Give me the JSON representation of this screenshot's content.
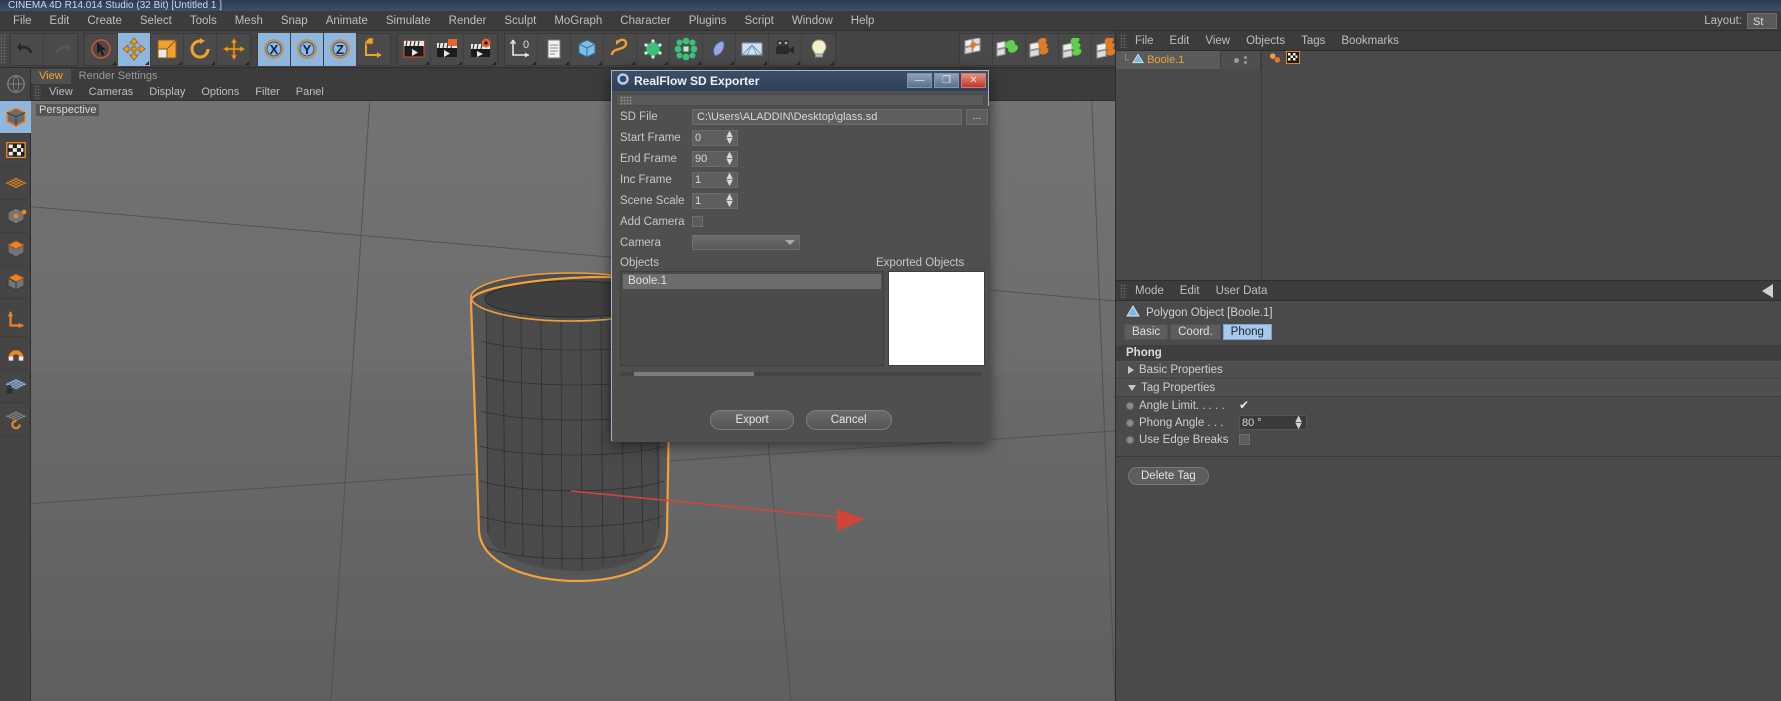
{
  "window": {
    "title": "CINEMA 4D R14.014 Studio (32 Bit)  [Untitled 1 ]"
  },
  "menubar": {
    "items": [
      "File",
      "Edit",
      "Create",
      "Select",
      "Tools",
      "Mesh",
      "Snap",
      "Animate",
      "Simulate",
      "Render",
      "Sculpt",
      "MoGraph",
      "Character",
      "Plugins",
      "Script",
      "Window",
      "Help"
    ],
    "layout_label": "Layout:",
    "layout_value": "St"
  },
  "toolbar": {
    "groups": [
      {
        "name": "history",
        "buttons": [
          {
            "icon": "undo-icon",
            "label": "Undo",
            "active": false,
            "corner": false
          },
          {
            "icon": "redo-icon",
            "label": "Redo",
            "active": false,
            "corner": false
          }
        ]
      },
      {
        "name": "transform",
        "buttons": [
          {
            "icon": "select-cursor-icon",
            "label": "Live Selection",
            "active": false,
            "corner": true
          },
          {
            "icon": "move-icon",
            "label": "Move",
            "active": true,
            "corner": true
          },
          {
            "icon": "scale-icon",
            "label": "Scale",
            "active": false,
            "corner": true
          },
          {
            "icon": "rotate-icon",
            "label": "Rotate",
            "active": false,
            "corner": true
          },
          {
            "icon": "plus-axis-icon",
            "label": "Modelling Axis",
            "active": false,
            "corner": true
          }
        ]
      },
      {
        "name": "axis-lock",
        "buttons": [
          {
            "icon": "x-axis-icon",
            "label": "Lock X Axis",
            "active": true,
            "corner": false
          },
          {
            "icon": "y-axis-icon",
            "label": "Lock Y Axis",
            "active": true,
            "corner": false
          },
          {
            "icon": "z-axis-icon",
            "label": "Lock Z Axis",
            "active": true,
            "corner": false
          },
          {
            "icon": "world-object-axis-icon",
            "label": "World / Object Coordinate System",
            "active": false,
            "corner": false
          }
        ]
      },
      {
        "name": "render",
        "buttons": [
          {
            "icon": "render-view-icon",
            "label": "Render View",
            "active": false,
            "corner": true
          },
          {
            "icon": "render-picture-viewer-icon",
            "label": "Render to Picture Viewer",
            "active": false,
            "corner": true
          },
          {
            "icon": "render-settings-icon",
            "label": "Edit Render Settings",
            "active": false,
            "corner": true
          }
        ]
      },
      {
        "name": "create",
        "buttons": [
          {
            "icon": "null-object-icon",
            "label": "Add Null Object",
            "active": false,
            "corner": true
          },
          {
            "icon": "floor-icon",
            "label": "Add Floor / Scene Object",
            "active": false,
            "corner": true
          },
          {
            "icon": "cube-primitive-icon",
            "label": "Add Cube Primitive",
            "active": false,
            "corner": true
          },
          {
            "icon": "spline-icon",
            "label": "Add Spline",
            "active": false,
            "corner": true
          },
          {
            "icon": "nurbs-icon",
            "label": "Add Generator NURBS",
            "active": false,
            "corner": true
          },
          {
            "icon": "array-icon",
            "label": "Add Modelling Object",
            "active": false,
            "corner": true
          },
          {
            "icon": "deformer-icon",
            "label": "Add Deformer",
            "active": false,
            "corner": true
          },
          {
            "icon": "environment-icon",
            "label": "Add Scene Environment",
            "active": false,
            "corner": true
          },
          {
            "icon": "camera-icon",
            "label": "Add Camera",
            "active": false,
            "corner": true
          },
          {
            "icon": "light-icon",
            "label": "Add Light",
            "active": false,
            "corner": true
          }
        ]
      },
      {
        "name": "snap",
        "buttons": [
          {
            "icon": "snap-quantize-icon",
            "label": "Enable Snapping",
            "active": false,
            "corner": false
          },
          {
            "icon": "snap-vertex-icon",
            "label": "Vertex Snap",
            "active": false,
            "corner": false
          },
          {
            "icon": "snap-edge-icon",
            "label": "Edge Snap",
            "active": false,
            "corner": false
          },
          {
            "icon": "snap-poly-icon",
            "label": "Polygon Snap",
            "active": false,
            "corner": false
          },
          {
            "icon": "snap-workplane-icon",
            "label": "Workplane Snap",
            "active": false,
            "corner": false
          }
        ]
      }
    ]
  },
  "left_toolbar": {
    "buttons": [
      {
        "icon": "make-editable-icon",
        "label": "Make Editable",
        "active": false
      },
      {
        "icon": "model-mode-icon",
        "label": "Model Mode",
        "active": true
      },
      {
        "icon": "texture-mode-icon",
        "label": "Texture Mode",
        "active": false
      },
      {
        "icon": "points-mode-icon",
        "label": "Points Mode",
        "active": false
      },
      {
        "icon": "edges-mode-icon",
        "label": "Edges Mode",
        "active": false
      },
      {
        "icon": "polygons-mode-icon",
        "label": "Polygons Mode",
        "active": false
      },
      {
        "icon": "object-axis-mode-icon",
        "label": "Enable Axis Modification",
        "active": false
      },
      {
        "icon": "magnet-icon",
        "label": "Magnet Tool",
        "active": false
      },
      {
        "icon": "workplane-lock-icon",
        "label": "Lock Workplane",
        "active": false
      },
      {
        "icon": "workplane-icon",
        "label": "Planar Workplane",
        "active": false
      }
    ]
  },
  "viewport": {
    "tabs": [
      {
        "label": "View",
        "active": true
      },
      {
        "label": "Render Settings",
        "active": false
      }
    ],
    "menu": [
      "View",
      "Cameras",
      "Display",
      "Options",
      "Filter",
      "Panel"
    ],
    "nav_icons": [
      "pan-icon",
      "dolly-icon",
      "rotate-view-icon",
      "maximize-view-icon"
    ],
    "perspective_label": "Perspective"
  },
  "object_manager": {
    "menu": [
      "File",
      "Edit",
      "View",
      "Objects",
      "Tags",
      "Bookmarks"
    ],
    "rows": [
      {
        "name": "Boole.1",
        "icon": "polygon-object-icon",
        "tags": [
          "texture-tag-icon",
          "phong-tag-icon"
        ]
      }
    ]
  },
  "attribute_manager": {
    "menu": [
      "Mode",
      "Edit",
      "User Data"
    ],
    "object_title": "Polygon Object [Boole.1]",
    "tabs": [
      {
        "label": "Basic",
        "active": false
      },
      {
        "label": "Coord.",
        "active": false
      },
      {
        "label": "Phong",
        "active": true
      }
    ],
    "section_title": "Phong",
    "groups": [
      {
        "label": "Basic Properties",
        "expanded": false
      },
      {
        "label": "Tag Properties",
        "expanded": true
      }
    ],
    "properties": [
      {
        "label": "Angle Limit. . . . .",
        "type": "checkbox",
        "value": "checked"
      },
      {
        "label": "Phong Angle . . .",
        "type": "number",
        "value": "80 °"
      },
      {
        "label": "Use Edge Breaks",
        "type": "checkbox",
        "value": "unchecked"
      }
    ],
    "delete_tag_label": "Delete Tag"
  },
  "dialog": {
    "title": "RealFlow SD Exporter",
    "window_buttons": [
      {
        "name": "minimize",
        "glyph": "—"
      },
      {
        "name": "maximize",
        "glyph": "❐"
      },
      {
        "name": "close",
        "glyph": "✕"
      }
    ],
    "fields": [
      {
        "label": "SD File",
        "type": "text",
        "value": "C:\\Users\\ALADDIN\\Desktop\\glass.sd",
        "browse": "..."
      },
      {
        "label": "Start Frame",
        "type": "number",
        "value": "0"
      },
      {
        "label": "End Frame",
        "type": "number",
        "value": "90"
      },
      {
        "label": "Inc Frame",
        "type": "number",
        "value": "1"
      },
      {
        "label": "Scene Scale",
        "type": "number",
        "value": "1"
      },
      {
        "label": "Add Camera",
        "type": "checkbox",
        "value": "unchecked"
      },
      {
        "label": "Camera",
        "type": "combo",
        "value": ""
      }
    ],
    "objects_label": "Objects",
    "exported_objects_label": "Exported Objects",
    "objects_list": [
      "Boole.1"
    ],
    "exported_list": [],
    "buttons": [
      {
        "name": "export",
        "label": "Export"
      },
      {
        "name": "cancel",
        "label": "Cancel"
      }
    ]
  }
}
